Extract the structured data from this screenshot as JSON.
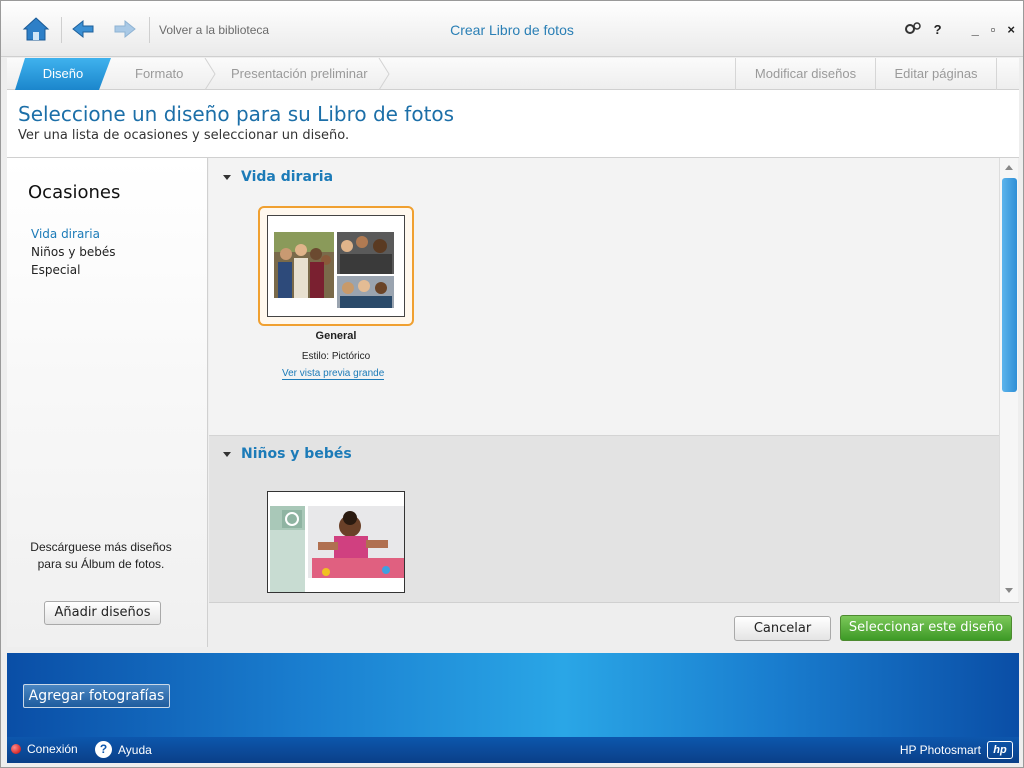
{
  "titlebar": {
    "back_library": "Volver a la biblioteca",
    "app_title": "Crear Libro de fotos",
    "settings_icon": "gears-icon",
    "help_symbol": "?",
    "minimize_symbol": "_",
    "restore_symbol": "▫",
    "close_symbol": "×"
  },
  "tabs": {
    "items": [
      {
        "label": "Diseño",
        "active": true
      },
      {
        "label": "Formato",
        "active": false
      },
      {
        "label": "Presentación preliminar",
        "active": false
      }
    ],
    "right": [
      {
        "label": "Modificar diseños"
      },
      {
        "label": "Editar páginas"
      }
    ]
  },
  "header": {
    "title": "Seleccione un diseño para su Libro de fotos",
    "subtitle": "Ver una lista de ocasiones y seleccionar un diseño."
  },
  "sidebar": {
    "title": "Ocasiones",
    "items": [
      {
        "label": "Vida diraria",
        "active": true
      },
      {
        "label": "Niños y bebés",
        "active": false
      },
      {
        "label": "Especial",
        "active": false
      }
    ],
    "download_text": "Descárguese más diseños para su Álbum de fotos.",
    "add_designs_button": "Añadir diseños"
  },
  "content": {
    "sections": [
      {
        "title": "Vida diraria",
        "design": {
          "name": "General",
          "style": "Estilo: Pictórico",
          "preview_link": "Ver vista previa grande"
        }
      },
      {
        "title": "Niños y bebés"
      }
    ]
  },
  "actions": {
    "cancel": "Cancelar",
    "select": "Seleccionar este diseño"
  },
  "band": {
    "add_photos": "Agregar fotografías"
  },
  "status": {
    "connection": "Conexión",
    "help": "Ayuda",
    "brand": "HP Photosmart",
    "brand_badge": "hp"
  },
  "colors": {
    "accent": "#1c7bb8",
    "tab_active": "#2a98dc",
    "selection": "#f0a030",
    "primary_button": "#3d9a26",
    "band": "#1a7fd0"
  }
}
